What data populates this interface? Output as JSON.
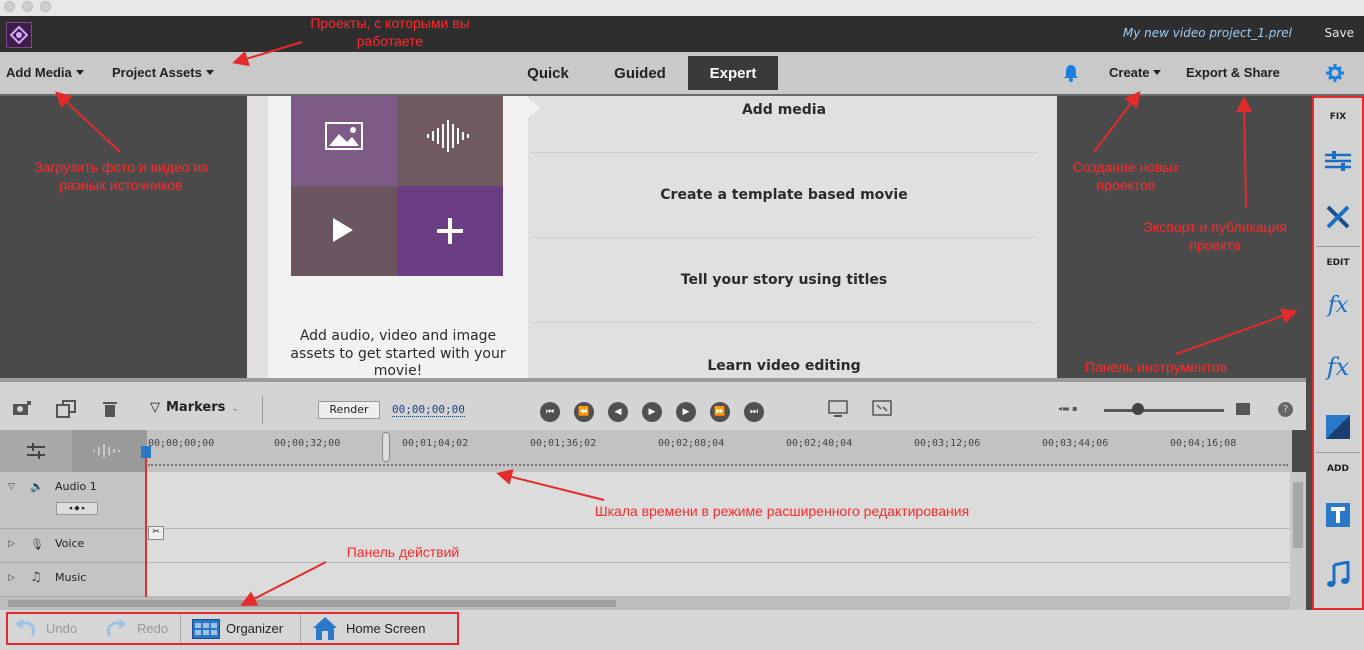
{
  "window": {
    "project_name": "My new video project_1.prel",
    "save": "Save"
  },
  "menubar": {
    "add_media": "Add Media",
    "project_assets": "Project Assets",
    "tabs": [
      "Quick",
      "Guided",
      "Expert"
    ],
    "active_tab": "Expert",
    "create": "Create",
    "export_share": "Export & Share"
  },
  "welcome": {
    "assets_text": "Add audio, video and image assets to get started with your movie!",
    "options": [
      "Add media",
      "Create a template based movie",
      "Tell your story using titles",
      "Learn video editing"
    ]
  },
  "tools": {
    "fix": "FIX",
    "edit": "EDIT",
    "add": "ADD"
  },
  "timeline": {
    "markers": "Markers",
    "render": "Render",
    "timecode": "00;00;00;00",
    "ruler_ticks": [
      "00;00;00;00",
      "00;00;32;00",
      "00;01;04;02",
      "00;01;36;02",
      "00;02;08;04",
      "00;02;40;04",
      "00;03;12;06",
      "00;03;44;06",
      "00;04;16;08"
    ],
    "tracks": [
      "Audio 1",
      "Voice",
      "Music"
    ]
  },
  "actionbar": {
    "undo": "Undo",
    "redo": "Redo",
    "organizer": "Organizer",
    "home_screen": "Home Screen"
  },
  "annotations": {
    "projects": "Проекты, с которыми вы работаете",
    "load": "Загрузить фото и видео из разных источников",
    "create": "Создание новых проектов",
    "export": "Экспорт и публикация проекта",
    "toolbar": "Панель инструментов",
    "timeline": "Шкала времени в режиме расширенного редактирования",
    "actions": "Панель действий"
  },
  "colors": {
    "accent_red": "#e32b2b",
    "title_bar": "#2e2e2e",
    "project_name": "#9ecbf4",
    "purple": "#6b3d82"
  }
}
